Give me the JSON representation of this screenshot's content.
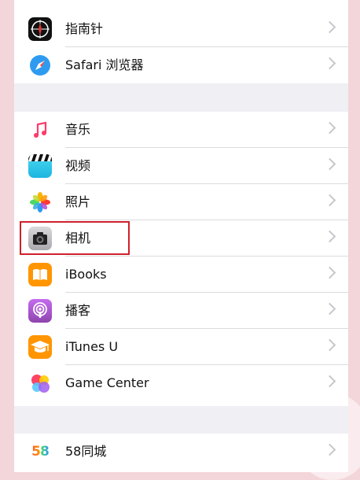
{
  "settings": {
    "group1": [
      {
        "label": "指南针",
        "icon": "compass-icon"
      },
      {
        "label": "Safari 浏览器",
        "icon": "safari-icon"
      }
    ],
    "group2": [
      {
        "label": "音乐",
        "icon": "music-icon"
      },
      {
        "label": "视频",
        "icon": "videos-icon"
      },
      {
        "label": "照片",
        "icon": "photos-icon"
      },
      {
        "label": "相机",
        "icon": "camera-icon"
      },
      {
        "label": "iBooks",
        "icon": "ibooks-icon"
      },
      {
        "label": "播客",
        "icon": "podcasts-icon"
      },
      {
        "label": "iTunes U",
        "icon": "itunes-u-icon"
      },
      {
        "label": "Game Center",
        "icon": "game-center-icon"
      }
    ],
    "group3": [
      {
        "label": "58同城",
        "icon_text": "58",
        "icon": "58-tongcheng-icon"
      }
    ]
  },
  "colors": {
    "highlight": "#d0202c",
    "background": "#efeff4",
    "chevron": "#c7c7cc"
  }
}
